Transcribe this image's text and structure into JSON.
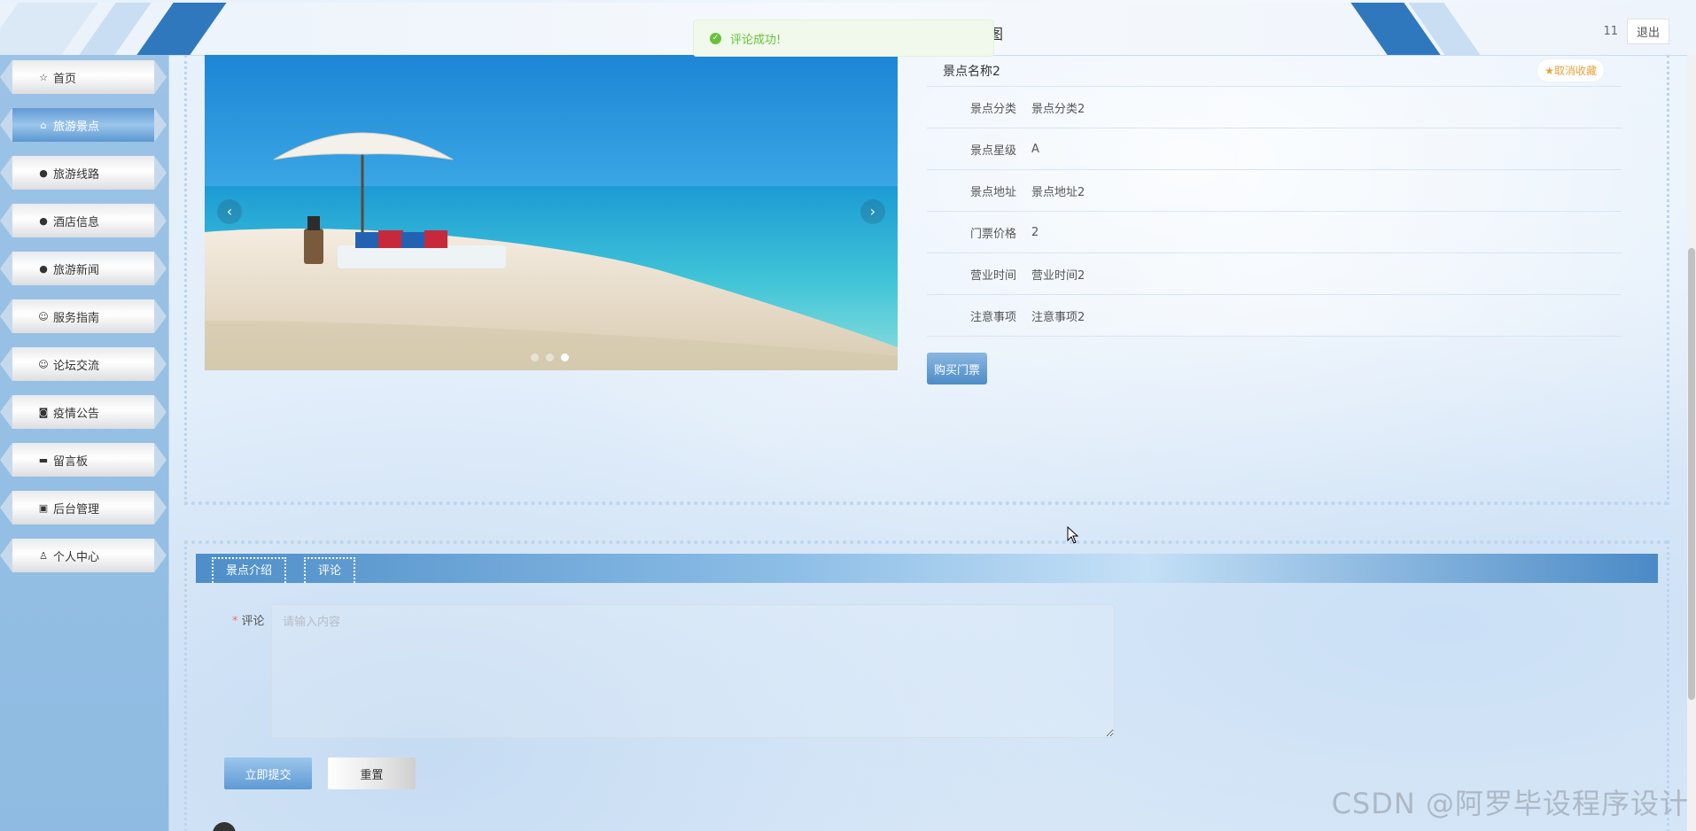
{
  "header": {
    "glyph": "图",
    "username": "11",
    "logout_label": "退出"
  },
  "toast": {
    "icon": "check-circle-icon",
    "message": "评论成功!",
    "color": "#67c23a"
  },
  "sidebar": {
    "items": [
      {
        "label": "首页",
        "icon": "star-outline-icon",
        "glyph": "☆"
      },
      {
        "label": "旅游景点",
        "icon": "home-icon",
        "glyph": "⌂",
        "active": true
      },
      {
        "label": "旅游线路",
        "icon": "alert-icon",
        "glyph": "●"
      },
      {
        "label": "酒店信息",
        "icon": "question-icon",
        "glyph": "●"
      },
      {
        "label": "旅游新闻",
        "icon": "info-icon",
        "glyph": "●"
      },
      {
        "label": "服务指南",
        "icon": "smile-icon",
        "glyph": "☺"
      },
      {
        "label": "论坛交流",
        "icon": "chat-icon",
        "glyph": "☺"
      },
      {
        "label": "疫情公告",
        "icon": "camera-icon",
        "glyph": "◙"
      },
      {
        "label": "留言板",
        "icon": "printer-icon",
        "glyph": "▬"
      },
      {
        "label": "后台管理",
        "icon": "briefcase-icon",
        "glyph": "▣"
      },
      {
        "label": "个人中心",
        "icon": "user-icon",
        "glyph": "♙"
      }
    ]
  },
  "carousel": {
    "prev_glyph": "‹",
    "next_glyph": "›",
    "slide_count": 3,
    "active_index": 2
  },
  "spot": {
    "name": "景点名称2",
    "favorite_label": "★取消收藏",
    "fields": [
      {
        "label": "景点分类",
        "value": "景点分类2"
      },
      {
        "label": "景点星级",
        "value": "A"
      },
      {
        "label": "景点地址",
        "value": "景点地址2"
      },
      {
        "label": "门票价格",
        "value": "2"
      },
      {
        "label": "营业时间",
        "value": "营业时间2"
      },
      {
        "label": "注意事项",
        "value": "注意事项2"
      }
    ],
    "buy_label": "购买门票"
  },
  "tabs": [
    {
      "label": "景点介绍"
    },
    {
      "label": "评论",
      "active": true
    }
  ],
  "comment_form": {
    "label": "评论",
    "required_mark": "*",
    "placeholder": "请输入内容",
    "value": "",
    "submit_label": "立即提交",
    "reset_label": "重置"
  },
  "watermark": "CSDN @阿罗毕设程序设计"
}
